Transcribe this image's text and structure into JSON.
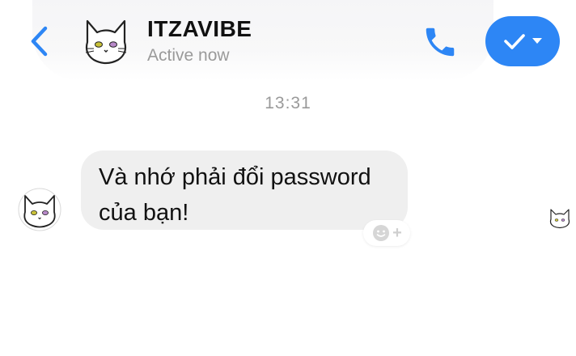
{
  "header": {
    "contact_name": "ITZAVIBE",
    "status": "Active now",
    "back_icon": "chevron-left-icon",
    "call_icon": "phone-icon",
    "action_icon": "checkmark-dropdown-icon"
  },
  "conversation": {
    "timestamp": "13:31",
    "messages": [
      {
        "sender": "ITZAVIBE",
        "line1": "Và nhớ phải đổi password",
        "line2": "của bạn!"
      }
    ],
    "reaction_icon": "add-reaction-icon",
    "reaction_plus": "+"
  },
  "colors": {
    "accent": "#2d86f5",
    "bubble": "#efefef",
    "muted_text": "#9a9a9a"
  }
}
